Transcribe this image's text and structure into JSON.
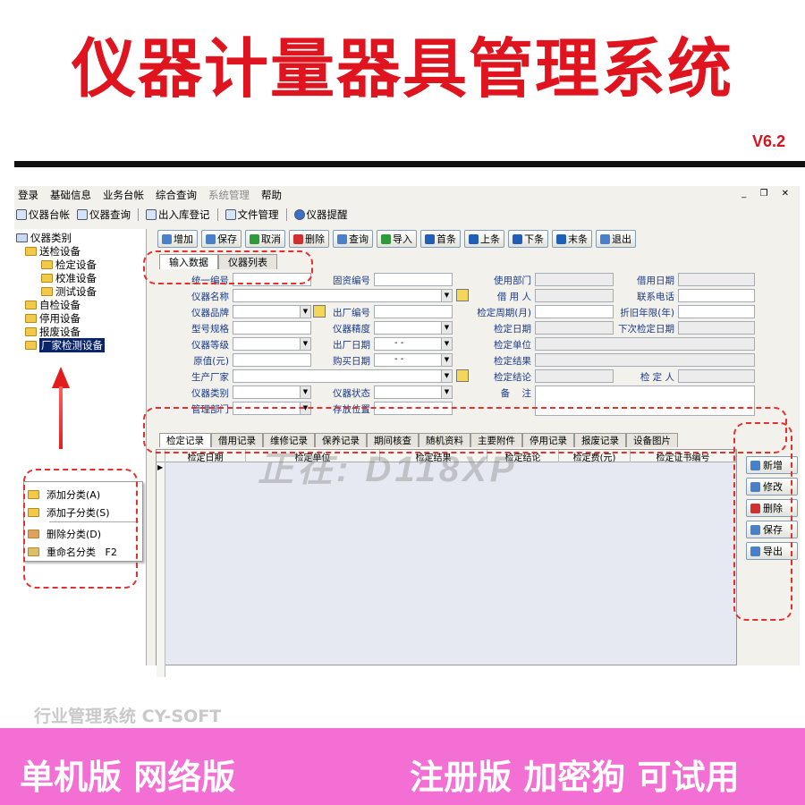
{
  "banner": {
    "title": "仪器计量器具管理系统",
    "version": "V6.2"
  },
  "menubar": {
    "items": [
      "登录",
      "基础信息",
      "业务台帐",
      "综合查询",
      "系统管理",
      "帮助"
    ],
    "win_ctrls": "_ ❐ ✕"
  },
  "toolbar": {
    "items": [
      "仪器台帐",
      "仪器查询",
      "出入库登记",
      "文件管理",
      "仪器提醒"
    ]
  },
  "tree": {
    "root": "仪器类别",
    "nodes": [
      "送检设备",
      "检定设备",
      "校准设备",
      "测试设备",
      "自检设备",
      "停用设备",
      "报废设备",
      "厂家检测设备"
    ]
  },
  "context_menu": {
    "items": [
      "添加分类(A)",
      "添加子分类(S)",
      "删除分类(D)",
      "重命名分类   F2"
    ]
  },
  "actions": {
    "items": [
      "增加",
      "保存",
      "取消",
      "删除",
      "查询",
      "导入",
      "首条",
      "上条",
      "下条",
      "末条",
      "退出"
    ]
  },
  "top_tabs": [
    "输入数据",
    "仪器列表"
  ],
  "form": {
    "col1": [
      "统一编号",
      "仪器名称",
      "仪器品牌",
      "型号规格",
      "仪器等级",
      "原值(元)",
      "生产厂家",
      "仪器类别",
      "管理部门"
    ],
    "col2": [
      "固资编号",
      "出厂编号",
      "仪器精度",
      "出厂日期",
      "购买日期",
      "仪器状态",
      "存放位置"
    ],
    "col3": [
      "使用部门",
      "借 用 人",
      "检定周期(月)",
      "检定日期",
      "检定单位",
      "检定结果",
      "检定结论",
      "备    注"
    ],
    "col4": [
      "借用日期",
      "联系电话",
      "折旧年限(年)",
      "下次检定日期",
      "检 定 人"
    ],
    "date_placeholder": "-   -"
  },
  "bottom_tabs": [
    "检定记录",
    "借用记录",
    "维修记录",
    "保养记录",
    "期间核查",
    "随机资料",
    "主要附件",
    "停用记录",
    "报废记录",
    "设备图片"
  ],
  "grid_columns": [
    "检定日期",
    "检定单位",
    "检定结果",
    "检定结论",
    "检定费(元)",
    "检定证书编号"
  ],
  "side_buttons": [
    "新增",
    "修改",
    "删除",
    "保存",
    "导出"
  ],
  "watermark": "正在: D118XP",
  "footer": {
    "company": "行业管理系统 CY-SOFT",
    "left": "单机版 网络版",
    "right": "注册版 加密狗 可试用"
  },
  "colors": {
    "title_red": "#e0141e",
    "band_pink": "#f36fd4",
    "dash_red": "#e53030"
  }
}
